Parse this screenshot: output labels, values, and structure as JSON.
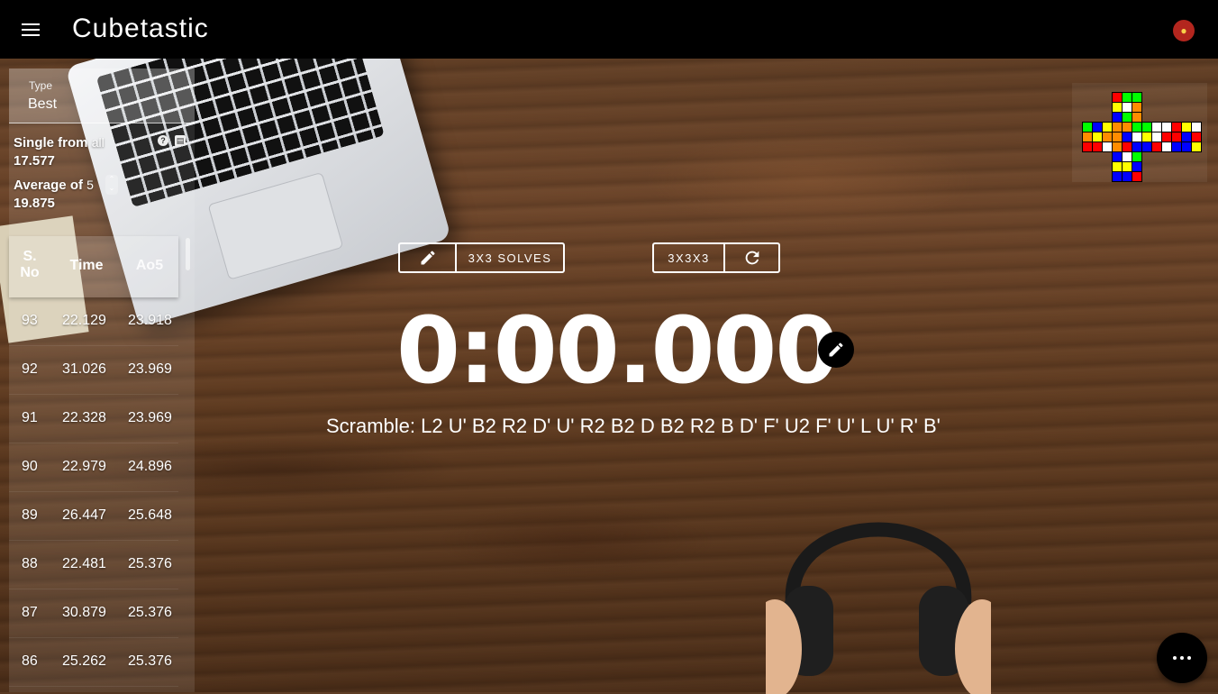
{
  "appbar": {
    "title": "Cubetastic"
  },
  "stats": {
    "type_label": "Type",
    "type_value": "Best",
    "single_label": "Single from",
    "single_scope": "all",
    "single_value": "17.577",
    "average_label": "Average of",
    "average_n": "5",
    "average_value": "19.875"
  },
  "table": {
    "headers": [
      "S. No",
      "Time",
      "Ao5"
    ],
    "rows": [
      [
        "93",
        "22.129",
        "23.918"
      ],
      [
        "92",
        "31.026",
        "23.969"
      ],
      [
        "91",
        "22.328",
        "23.969"
      ],
      [
        "90",
        "22.979",
        "24.896"
      ],
      [
        "89",
        "26.447",
        "25.648"
      ],
      [
        "88",
        "22.481",
        "25.376"
      ],
      [
        "87",
        "30.879",
        "25.376"
      ],
      [
        "86",
        "25.262",
        "25.376"
      ]
    ]
  },
  "session": {
    "name_label": "3X3 SOLVES"
  },
  "puzzle": {
    "type_label": "3X3X3"
  },
  "timer": {
    "display": "0:00.000"
  },
  "scramble": {
    "text": "Scramble: L2 U' B2 R2 D' U' R2 B2 D B2 R2 B D' F' U2 F' U' L U' R' B'"
  },
  "icons": {
    "menu": "menu-icon",
    "avatar": "iron-man-avatar-icon",
    "edit": "pencil-icon",
    "refresh": "refresh-icon",
    "more": "more-horizontal-icon",
    "help": "help-icon",
    "chart": "chart-icon"
  },
  "cube_net": {
    "U": [
      "r",
      "g",
      "g",
      "y",
      "w",
      "o",
      "b",
      "g",
      "o"
    ],
    "L": [
      "g",
      "b",
      "y",
      "o",
      "y",
      "o",
      "r",
      "r",
      "w"
    ],
    "F": [
      "o",
      "o",
      "g",
      "o",
      "b",
      "w",
      "o",
      "r",
      "b"
    ],
    "R": [
      "g",
      "w",
      "w",
      "y",
      "w",
      "r",
      "b",
      "r",
      "w"
    ],
    "B": [
      "r",
      "y",
      "w",
      "r",
      "b",
      "r",
      "b",
      "b",
      "y"
    ],
    "D": [
      "b",
      "w",
      "g",
      "y",
      "y",
      "b",
      "b",
      "b",
      "r"
    ]
  },
  "colors": {
    "w": "#ffffff",
    "y": "#ffff00",
    "r": "#ff0000",
    "o": "#ff8c00",
    "g": "#00ff00",
    "b": "#0000ff",
    "accent": "#000000"
  }
}
